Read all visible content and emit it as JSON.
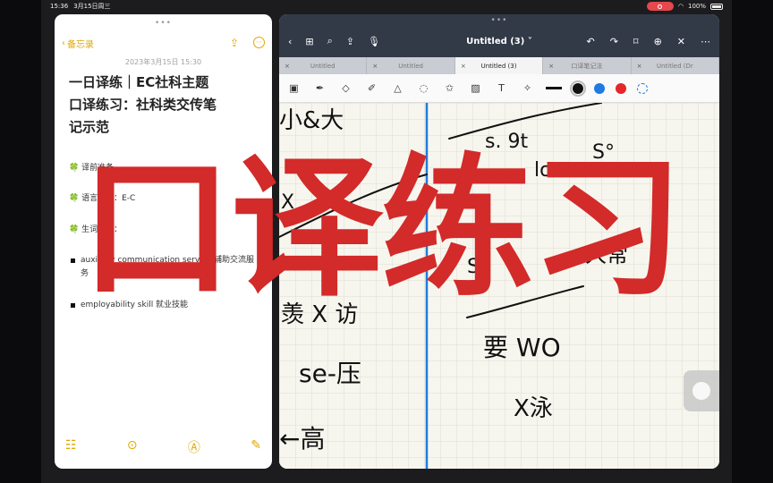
{
  "status_bar": {
    "time": "15:36",
    "date": "3月15日周三",
    "battery": "100%"
  },
  "notes_app": {
    "back_label": "备忘录",
    "date": "2023年3月15日 15:30",
    "title_lines": [
      "一日译练｜EC社科主题",
      "口译练习：社科类交传笔",
      "记示范"
    ],
    "lines": [
      {
        "icon": "🍀",
        "text": "译前准备"
      },
      {
        "icon": "🍀",
        "text": "语言方向：E-C"
      },
      {
        "icon": "🍀",
        "text": "生词储备："
      }
    ],
    "bullets": [
      "auxiliary communication service 辅助交流服务",
      "employability skill 就业技能"
    ]
  },
  "goodnotes": {
    "doc_title": "Untitled (3)",
    "tabs": [
      {
        "label": "Untitled",
        "active": false
      },
      {
        "label": "Untitled",
        "active": false
      },
      {
        "label": "Untitled (3)",
        "active": true
      },
      {
        "label": "口译笔记法",
        "active": false
      },
      {
        "label": "Untitled (Dr",
        "active": false
      }
    ],
    "colors": {
      "black": "#111111",
      "blue": "#1e7be0",
      "red": "#e5262a"
    },
    "handwriting": [
      "小&大",
      "s. 9t",
      "lo",
      "S°",
      "X",
      "S",
      "人常",
      "羡 X 访",
      "要 WO",
      "se-压",
      "X泳",
      "←高"
    ]
  },
  "overlay_title": "口译练习",
  "accent": "#d32a2a"
}
